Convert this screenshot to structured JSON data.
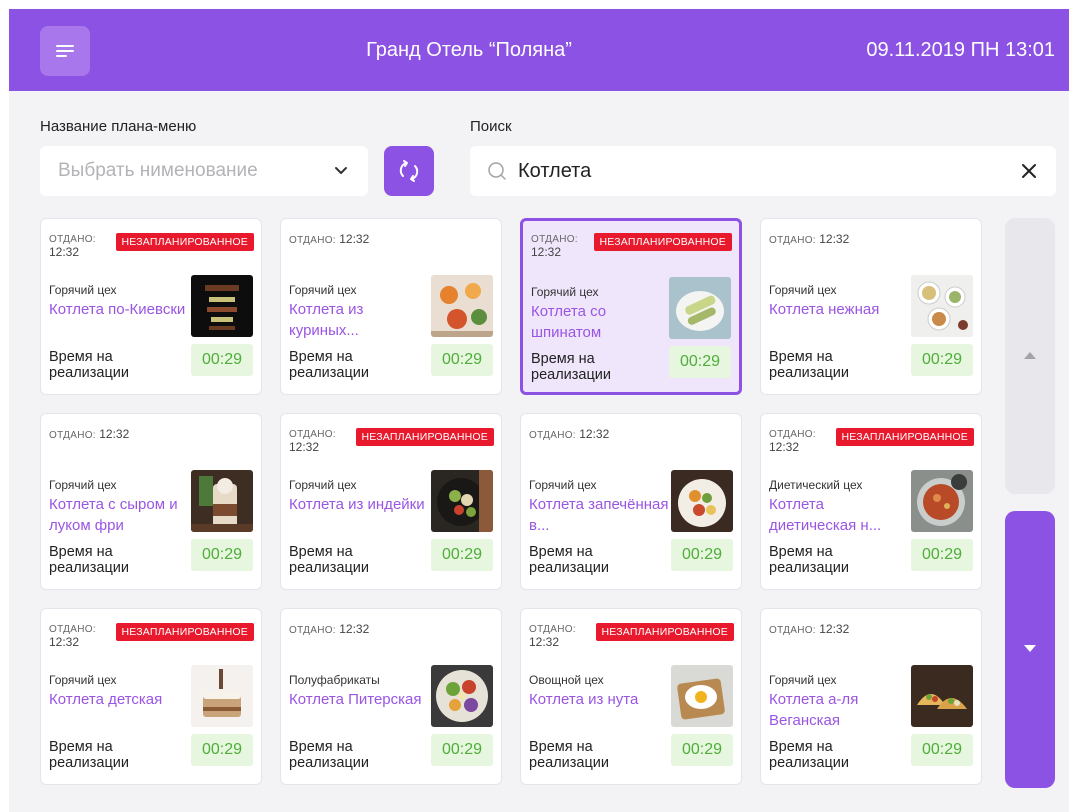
{
  "header": {
    "hotel": "Гранд Отель “Поляна”",
    "datetime": "09.11.2019 ПН 13:01"
  },
  "filters": {
    "menu_label": "Название плана-меню",
    "menu_placeholder": "Выбрать нимeнование",
    "search_label": "Поиск",
    "search_value": "Котлета"
  },
  "card_common": {
    "given_label": "ОТДАНО:",
    "time_label": "Время на реализации",
    "badge": "НЕЗАПЛАНИРОВАННОЕ"
  },
  "cards": [
    {
      "given_time": "12:32",
      "unplanned": true,
      "workshop": "Горячий цех",
      "dish": "Котлета по-Киевски",
      "timer": "00:29",
      "photo": "dark-skewers"
    },
    {
      "given_time": "12:32",
      "unplanned": false,
      "workshop": "Горячий цех",
      "dish": "Котлета из куриных...",
      "timer": "00:29",
      "photo": "drinks-table"
    },
    {
      "given_time": "12:32",
      "unplanned": true,
      "workshop": "Горячий цех",
      "dish": "Котлета со шпинатом",
      "timer": "00:29",
      "photo": "plate-rolls",
      "selected": true
    },
    {
      "given_time": "12:32",
      "unplanned": false,
      "workshop": "Горячий цех",
      "dish": "Котлета нежная",
      "timer": "00:29",
      "photo": "bowls-top"
    },
    {
      "given_time": "12:32",
      "unplanned": false,
      "workshop": "Горячий цех",
      "dish": "Котлета с сыром и луком фри",
      "timer": "00:29",
      "photo": "dessert-jar"
    },
    {
      "given_time": "12:32",
      "unplanned": true,
      "workshop": "Горячий цех",
      "dish": "Котлета из индейки",
      "timer": "00:29",
      "photo": "salad-dark"
    },
    {
      "given_time": "12:32",
      "unplanned": false,
      "workshop": "Горячий цех",
      "dish": "Котлета запечённая в...",
      "timer": "00:29",
      "photo": "plate-colorful"
    },
    {
      "given_time": "12:32",
      "unplanned": true,
      "workshop": "Диетический цех",
      "dish": "Котлета диетическая н...",
      "timer": "00:29",
      "photo": "soup-bowl"
    },
    {
      "given_time": "12:32",
      "unplanned": true,
      "workshop": "Горячий цех",
      "dish": "Котлета детская",
      "timer": "00:29",
      "photo": "cake"
    },
    {
      "given_time": "12:32",
      "unplanned": false,
      "workshop": "Полуфабрикаты",
      "dish": "Котлета Питерская",
      "timer": "00:29",
      "photo": "veg-bowl"
    },
    {
      "given_time": "12:32",
      "unplanned": true,
      "workshop": "Овощной цех",
      "dish": "Котлета из нута",
      "timer": "00:29",
      "photo": "egg-toast"
    },
    {
      "given_time": "12:32",
      "unplanned": false,
      "workshop": "Горячий цех",
      "dish": "Котлета а-ля Веганская",
      "timer": "00:29",
      "photo": "tacos"
    }
  ],
  "colors": {
    "accent": "#8c52e4",
    "badge": "#e8192c",
    "timer_bg": "#e7f6de",
    "timer_text": "#4eae3a",
    "dish_text": "#9a55e3"
  },
  "icons": {
    "menu": "hamburger-icon",
    "refresh": "refresh-icon",
    "dropdown": "chevron-down-icon",
    "search": "search-icon",
    "clear": "close-icon",
    "scroll_up": "triangle-up-icon",
    "scroll_down": "triangle-down-icon"
  }
}
